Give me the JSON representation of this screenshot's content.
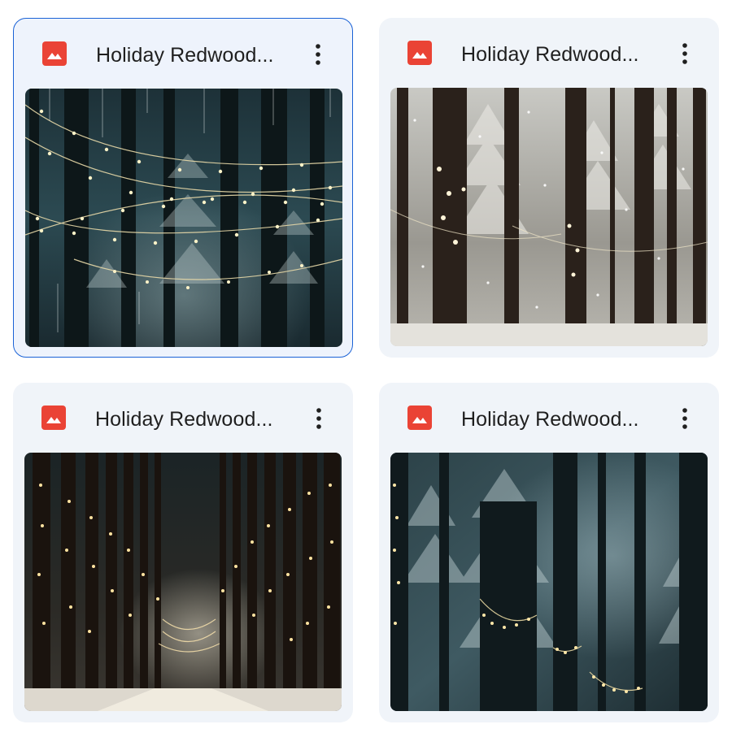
{
  "files": [
    {
      "title": "Holiday Redwood...",
      "selected": true,
      "icon": "image-file-icon",
      "thumbnail": "snowy-forest-string-lights-dark-teal"
    },
    {
      "title": "Holiday Redwood...",
      "selected": false,
      "icon": "image-file-icon",
      "thumbnail": "snowy-redwoods-white-mist-lights"
    },
    {
      "title": "Holiday Redwood...",
      "selected": false,
      "icon": "image-file-icon",
      "thumbnail": "redwood-avenue-fairy-lights-snow-path"
    },
    {
      "title": "Holiday Redwood...",
      "selected": false,
      "icon": "image-file-icon",
      "thumbnail": "snowy-forest-blue-dusk-lights"
    }
  ],
  "more_options_icon": "more-vert-icon",
  "colors": {
    "accent": "#1a62d6",
    "card_bg": "#f0f4f9",
    "image_icon": "#ea4335"
  }
}
